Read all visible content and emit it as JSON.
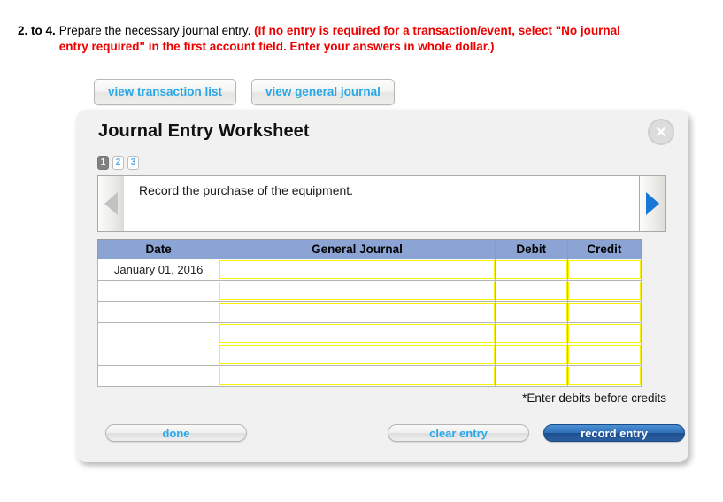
{
  "question": {
    "number": "2. to 4.",
    "plain_text": "Prepare the necessary journal entry.",
    "alert_text": "(If no entry is required for a transaction/event, select \"No journal entry required\" in the first account field. Enter your answers in whole dollar.)",
    "alert_color": "#ee0000"
  },
  "view_buttons": [
    {
      "label": "view transaction list",
      "name": "view-transaction-list-button"
    },
    {
      "label": "view general journal",
      "name": "view-general-journal-button"
    }
  ],
  "panel": {
    "title": "Journal Entry Worksheet",
    "close_icon": "close-icon",
    "close_glyph": "✕",
    "accent_color": "#29a7e8",
    "header_color": "#8ba4d4",
    "field_border_color": "#f6f200"
  },
  "steps": [
    {
      "label": "1",
      "state": "active"
    },
    {
      "label": "2",
      "state": "inactive"
    },
    {
      "label": "3",
      "state": "inactive"
    }
  ],
  "transaction": {
    "description": "Record the purchase of the equipment.",
    "prev_arrow": {
      "name": "prev-transaction-arrow",
      "enabled": false,
      "color": "#c2c2c2"
    },
    "next_arrow": {
      "name": "next-transaction-arrow",
      "enabled": true,
      "color": "#1878d8"
    }
  },
  "table": {
    "columns": [
      "Date",
      "General Journal",
      "Debit",
      "Credit"
    ],
    "rows": [
      {
        "date": "January 01, 2016",
        "general_journal": "",
        "debit": "",
        "credit": ""
      },
      {
        "date": "",
        "general_journal": "",
        "debit": "",
        "credit": ""
      },
      {
        "date": "",
        "general_journal": "",
        "debit": "",
        "credit": ""
      },
      {
        "date": "",
        "general_journal": "",
        "debit": "",
        "credit": ""
      },
      {
        "date": "",
        "general_journal": "",
        "debit": "",
        "credit": ""
      },
      {
        "date": "",
        "general_journal": "",
        "debit": "",
        "credit": ""
      }
    ]
  },
  "footnote": "*Enter debits before credits",
  "footer_buttons": {
    "done": "done",
    "clear_entry": "clear entry",
    "record_entry": "record entry"
  }
}
